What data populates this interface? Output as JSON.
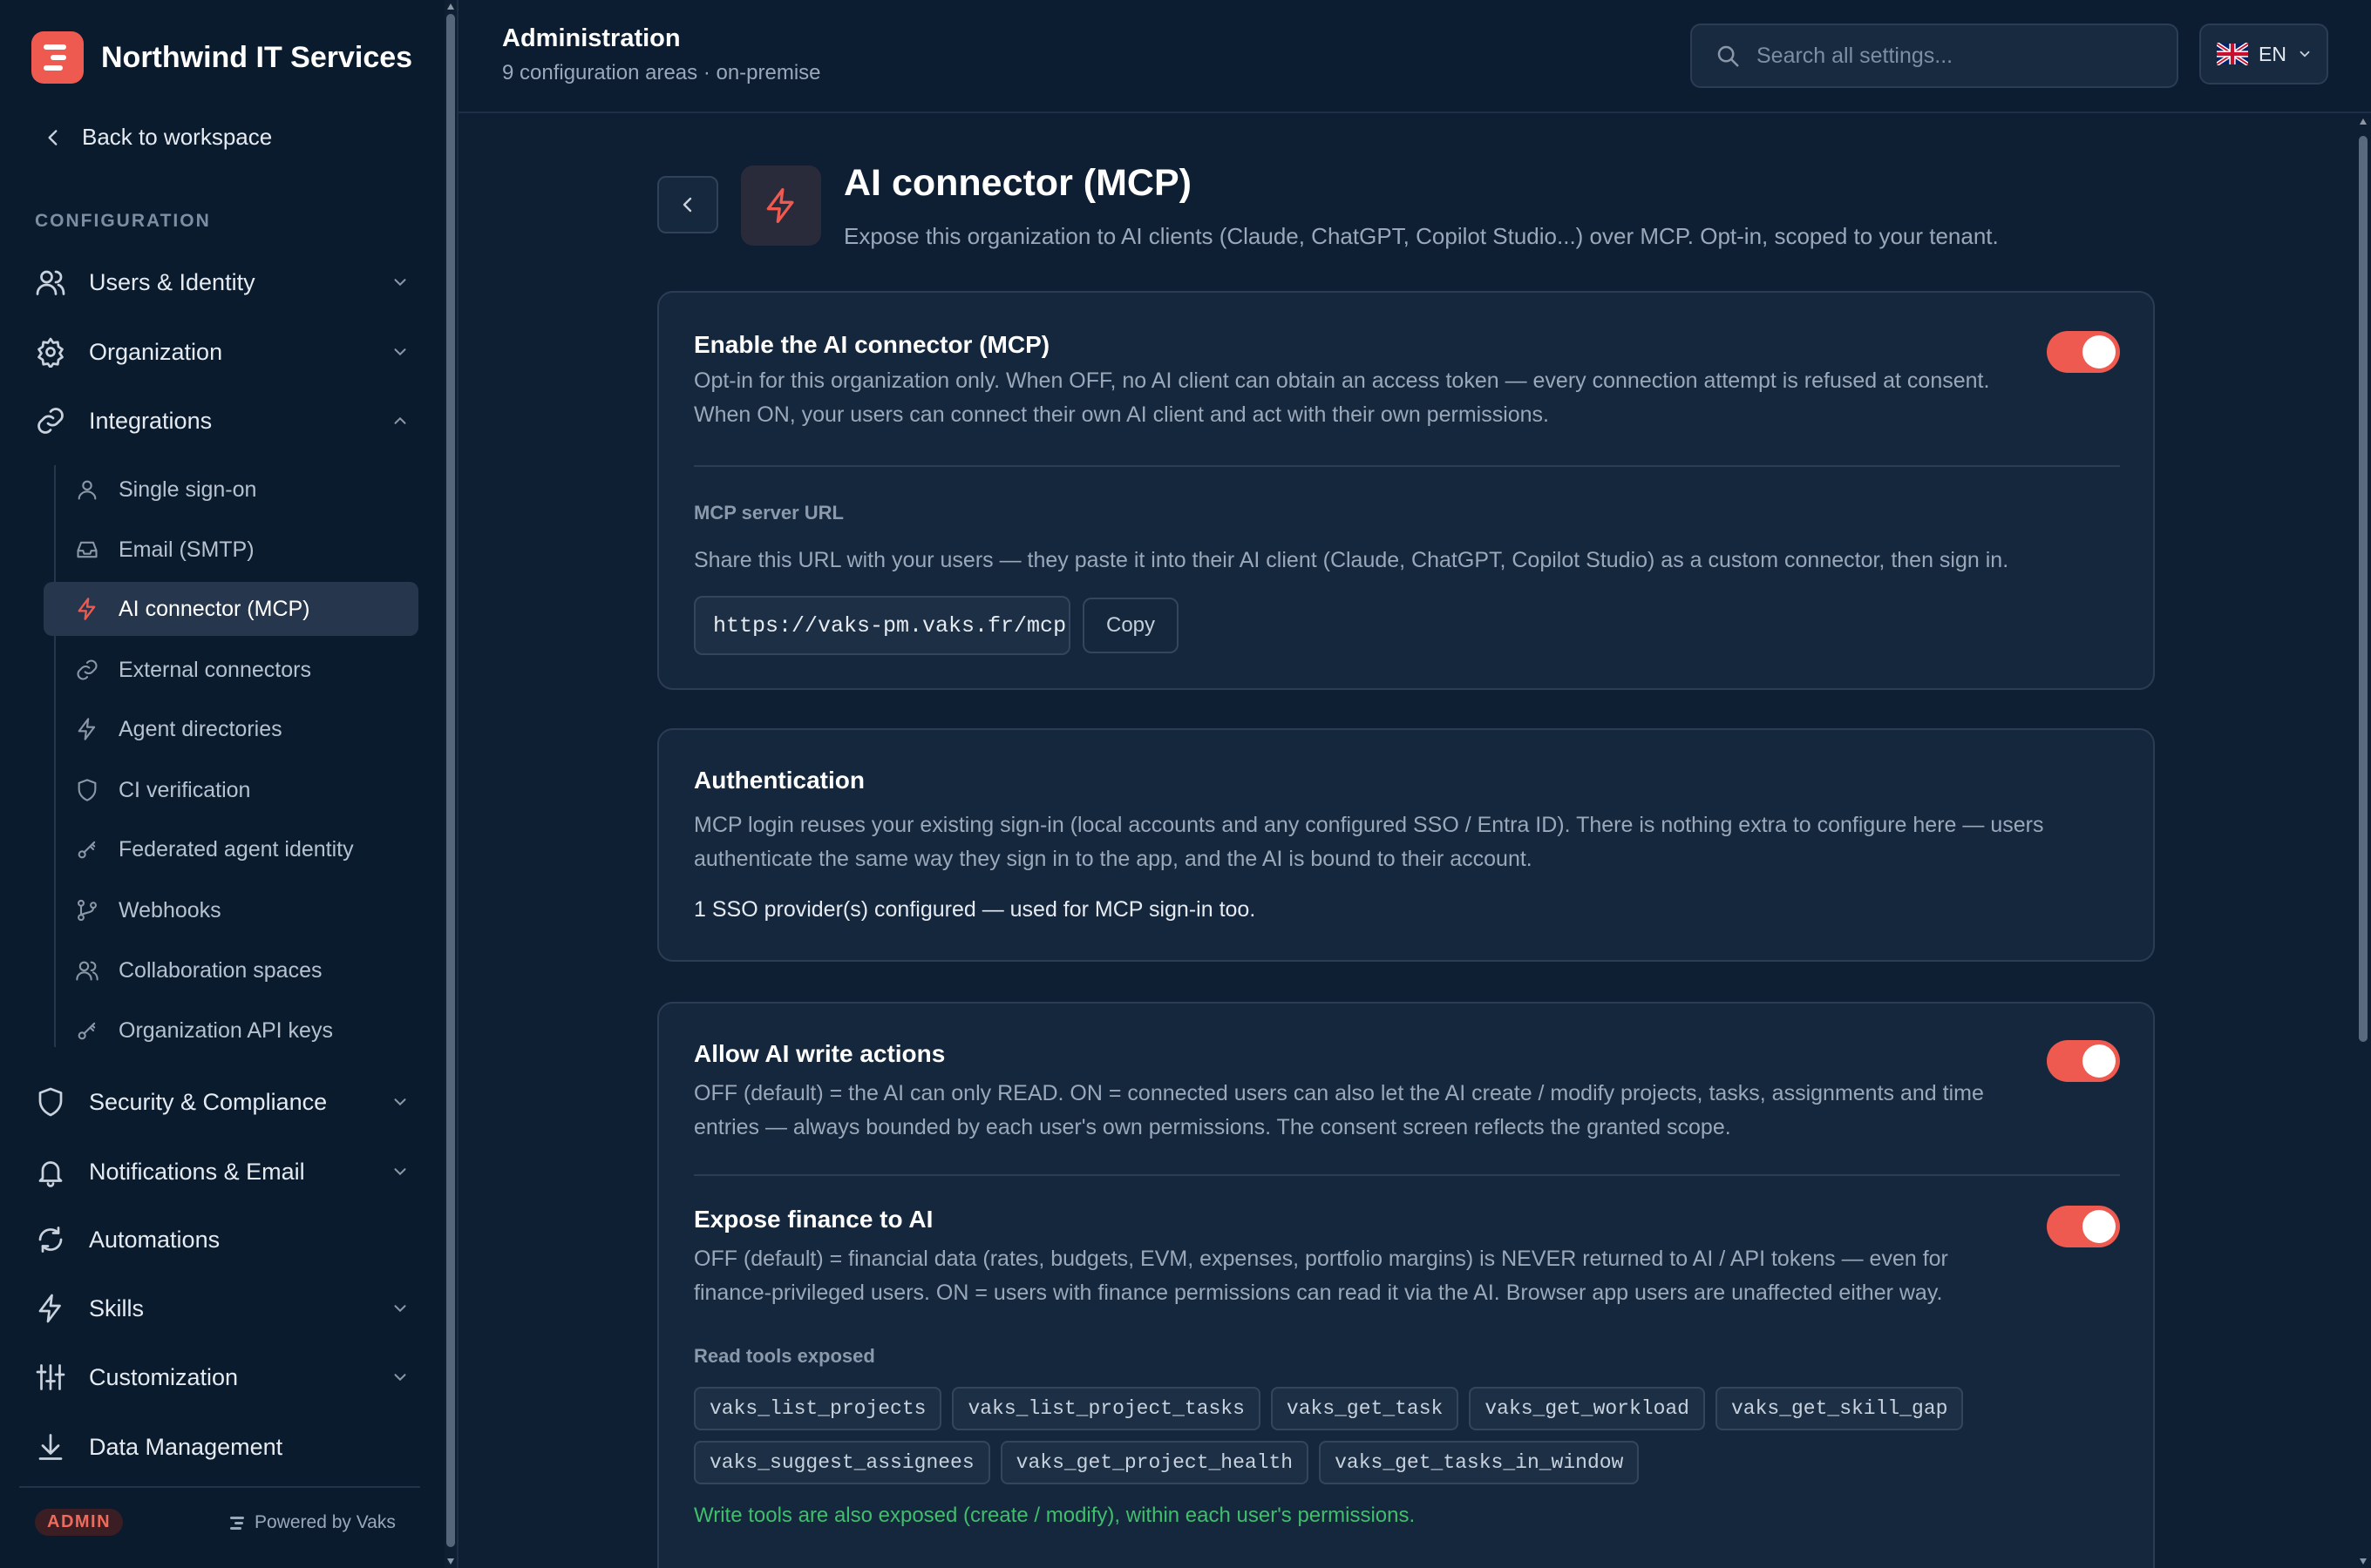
{
  "brand": {
    "name": "Northwind IT Services"
  },
  "sidebar": {
    "back_label": "Back to workspace",
    "section_label": "CONFIGURATION",
    "items": [
      {
        "label": "Users & Identity",
        "icon": "users-icon"
      },
      {
        "label": "Organization",
        "icon": "gear-icon"
      },
      {
        "label": "Integrations",
        "icon": "link-icon",
        "expanded": true
      },
      {
        "label": "Security & Compliance",
        "icon": "shield-icon"
      },
      {
        "label": "Notifications & Email",
        "icon": "bell-icon"
      },
      {
        "label": "Automations",
        "icon": "refresh-icon"
      },
      {
        "label": "Skills",
        "icon": "bolt-icon"
      },
      {
        "label": "Customization",
        "icon": "sliders-icon"
      },
      {
        "label": "Data Management",
        "icon": "download-icon"
      }
    ],
    "integrations_sub": [
      {
        "label": "Single sign-on",
        "icon": "user-icon"
      },
      {
        "label": "Email (SMTP)",
        "icon": "inbox-icon"
      },
      {
        "label": "AI connector (MCP)",
        "icon": "bolt-icon",
        "active": true
      },
      {
        "label": "External connectors",
        "icon": "link-icon"
      },
      {
        "label": "Agent directories",
        "icon": "bolt-icon"
      },
      {
        "label": "CI verification",
        "icon": "shield-icon"
      },
      {
        "label": "Federated agent identity",
        "icon": "key-icon"
      },
      {
        "label": "Webhooks",
        "icon": "git-branch-icon"
      },
      {
        "label": "Collaboration spaces",
        "icon": "users-icon"
      },
      {
        "label": "Organization API keys",
        "icon": "key-icon"
      }
    ],
    "admin_badge": "ADMIN",
    "powered_by": "Powered by Vaks"
  },
  "header": {
    "title": "Administration",
    "subtitle": "9 configuration areas · on-premise",
    "search_placeholder": "Search all settings...",
    "language": "EN"
  },
  "page": {
    "title": "AI connector (MCP)",
    "description": "Expose this organization to AI clients (Claude, ChatGPT, Copilot Studio...) over MCP. Opt-in, scoped to your tenant."
  },
  "connector_card": {
    "enable_title": "Enable the AI connector (MCP)",
    "enable_desc": "Opt-in for this organization only. When OFF, no AI client can obtain an access token — every connection attempt is refused at consent. When ON, your users can connect their own AI client and act with their own permissions.",
    "enabled": true,
    "url_label": "MCP server URL",
    "url_desc": "Share this URL with your users — they paste it into their AI client (Claude, ChatGPT, Copilot Studio) as a custom connector, then sign in.",
    "url": "https://vaks-pm.vaks.fr/mcp",
    "copy_label": "Copy"
  },
  "auth_card": {
    "title": "Authentication",
    "desc": "MCP login reuses your existing sign-in (local accounts and any configured SSO / Entra ID). There is nothing extra to configure here — users authenticate the same way they sign in to the app, and the AI is bound to their account.",
    "status": "1 SSO provider(s) configured — used for MCP sign-in too."
  },
  "permissions_card": {
    "write_title": "Allow AI write actions",
    "write_desc": "OFF (default) = the AI can only READ. ON = connected users can also let the AI create / modify projects, tasks, assignments and time entries — always bounded by each user's own permissions. The consent screen reflects the granted scope.",
    "write_enabled": true,
    "finance_title": "Expose finance to AI",
    "finance_desc": "OFF (default) = financial data (rates, budgets, EVM, expenses, portfolio margins) is NEVER returned to AI / API tokens — even for finance-privileged users. ON = users with finance permissions can read it via the AI. Browser app users are unaffected either way.",
    "finance_enabled": true,
    "tools_label": "Read tools exposed",
    "tools": [
      "vaks_list_projects",
      "vaks_list_project_tasks",
      "vaks_get_task",
      "vaks_get_workload",
      "vaks_get_skill_gap",
      "vaks_suggest_assignees",
      "vaks_get_project_health",
      "vaks_get_tasks_in_window"
    ],
    "write_note": "Write tools are also exposed (create / modify), within each user's permissions."
  },
  "colors": {
    "accent": "#ee5a4f",
    "success": "#3fbf6c",
    "background": "#0f1f33",
    "sidebar": "#0a1b2e"
  }
}
